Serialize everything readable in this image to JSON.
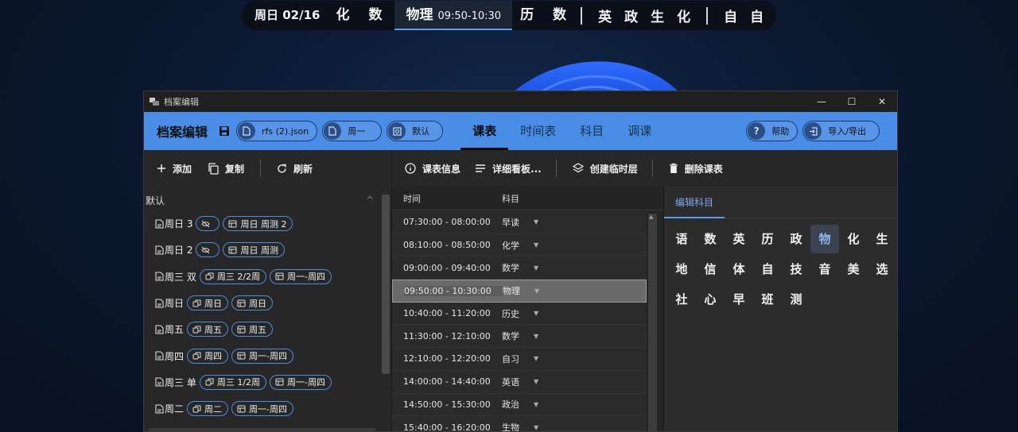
{
  "topbar": {
    "date": "周日 02/16",
    "before": [
      "化",
      "数"
    ],
    "current": {
      "subject": "物理",
      "time": "09:50-10:30"
    },
    "after": [
      "历",
      "数"
    ],
    "group2": [
      "英",
      "政",
      "生",
      "化"
    ],
    "group3": [
      "自",
      "自"
    ]
  },
  "window": {
    "title": "档案编辑",
    "min_glyph": "—",
    "max_glyph": "☐",
    "close_glyph": "✕"
  },
  "appbar": {
    "name": "档案编辑",
    "file_pill": "rfs (2).json",
    "day_pill": "周一",
    "default_pill": "默认",
    "tabs": [
      "课表",
      "时间表",
      "科目",
      "调课"
    ],
    "active_tab": "课表",
    "help": "帮助",
    "import_export": "导入/导出"
  },
  "left_toolbar": {
    "add": "添加",
    "copy": "复制",
    "refresh": "刷新"
  },
  "group": {
    "name": "默认",
    "chevron": "^"
  },
  "profiles": [
    {
      "name": "周日 3",
      "chips": [
        {
          "kind": "off",
          "label": ""
        },
        {
          "kind": "table",
          "label": "周日 周测 2"
        }
      ]
    },
    {
      "name": "周日 2",
      "chips": [
        {
          "kind": "off",
          "label": ""
        },
        {
          "kind": "table",
          "label": "周日 周测"
        }
      ]
    },
    {
      "name": "周三 双",
      "chips": [
        {
          "kind": "link",
          "label": "周三 2/2周"
        },
        {
          "kind": "table",
          "label": "周一-周四"
        }
      ]
    },
    {
      "name": "周日",
      "chips": [
        {
          "kind": "link",
          "label": "周日"
        },
        {
          "kind": "table",
          "label": "周日"
        }
      ]
    },
    {
      "name": "周五",
      "chips": [
        {
          "kind": "link",
          "label": "周五"
        },
        {
          "kind": "table",
          "label": "周五"
        }
      ]
    },
    {
      "name": "周四",
      "chips": [
        {
          "kind": "link",
          "label": "周四"
        },
        {
          "kind": "table",
          "label": "周一-周四"
        }
      ]
    },
    {
      "name": "周三 单",
      "chips": [
        {
          "kind": "link",
          "label": "周三 1/2周"
        },
        {
          "kind": "table",
          "label": "周一-周四"
        }
      ]
    },
    {
      "name": "周二",
      "chips": [
        {
          "kind": "link",
          "label": "周二"
        },
        {
          "kind": "table",
          "label": "周一-周四"
        }
      ]
    }
  ],
  "mid_toolbar": {
    "info": "课表信息",
    "board": "详细看板...",
    "temp_layer": "创建临时层",
    "delete": "删除课表"
  },
  "schedule": {
    "col_time": "时间",
    "col_subject": "科目",
    "rows": [
      {
        "time": "07:30:00 - 08:00:00",
        "subject": "早读"
      },
      {
        "time": "08:10:00 - 08:50:00",
        "subject": "化学"
      },
      {
        "time": "09:00:00 - 09:40:00",
        "subject": "数学"
      },
      {
        "time": "09:50:00 - 10:30:00",
        "subject": "物理",
        "selected": true
      },
      {
        "time": "10:40:00 - 11:20:00",
        "subject": "历史"
      },
      {
        "time": "11:30:00 - 12:10:00",
        "subject": "数学"
      },
      {
        "time": "12:10:00 - 12:20:00",
        "subject": "自习"
      },
      {
        "time": "14:00:00 - 14:40:00",
        "subject": "英语"
      },
      {
        "time": "14:50:00 - 15:30:00",
        "subject": "政治"
      },
      {
        "time": "15:40:00 - 16:20:00",
        "subject": "生物"
      }
    ]
  },
  "subject_panel": {
    "tab": "编辑科目",
    "subjects": [
      "语",
      "数",
      "英",
      "历",
      "政",
      "物",
      "化",
      "生",
      "地",
      "信",
      "体",
      "自",
      "技",
      "音",
      "美",
      "选",
      "社",
      "心",
      "早",
      "班",
      "测"
    ],
    "selected": "物"
  },
  "colors": {
    "accent": "#4a8de6",
    "highlight": "#5a9bf6"
  }
}
